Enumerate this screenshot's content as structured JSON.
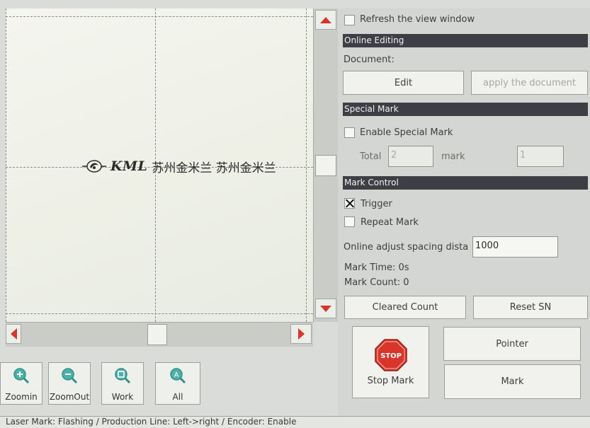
{
  "canvas": {
    "logo_text": "KML",
    "logo_cn": "苏州金米兰  苏州金米兰"
  },
  "toolbar": {
    "zoom_in": "Zoomin",
    "zoom_out": "ZoomOut",
    "work": "Work",
    "all": "All"
  },
  "status_bar": {
    "text": "Laser Mark: Flashing  /  Production Line: Left->right  /  Encoder: Enable"
  },
  "panel": {
    "refresh_label": "Refresh the view window",
    "refresh_checked": false,
    "online_editing": {
      "header": "Online Editing",
      "document_label": "Document:",
      "edit_label": "Edit",
      "apply_label": "apply the document"
    },
    "special_mark": {
      "header": "Special Mark",
      "enable_label": "Enable Special Mark",
      "enable_checked": false,
      "total_label": "Total",
      "total_value": "2",
      "mark_label": "mark",
      "mark_value": "1"
    },
    "mark_control": {
      "header": "Mark Control",
      "trigger_label": "Trigger",
      "trigger_checked": true,
      "repeat_label": "Repeat Mark",
      "repeat_checked": false,
      "spacing_label": "Online adjust spacing dista",
      "spacing_value": "1000",
      "mark_time": "Mark Time: 0s",
      "mark_count": "Mark Count: 0",
      "cleared_count_label": "Cleared Count",
      "reset_sn_label": "Reset SN"
    },
    "actions": {
      "stop_icon_text": "STOP",
      "stop_mark_label": "Stop Mark",
      "pointer_label": "Pointer",
      "mark_label": "Mark"
    }
  },
  "colors": {
    "header_bg": "#3e3f45",
    "arrow_red": "#d9362b",
    "stop_red": "#d9362b",
    "tool_icon_teal": "#2f8f8a"
  }
}
